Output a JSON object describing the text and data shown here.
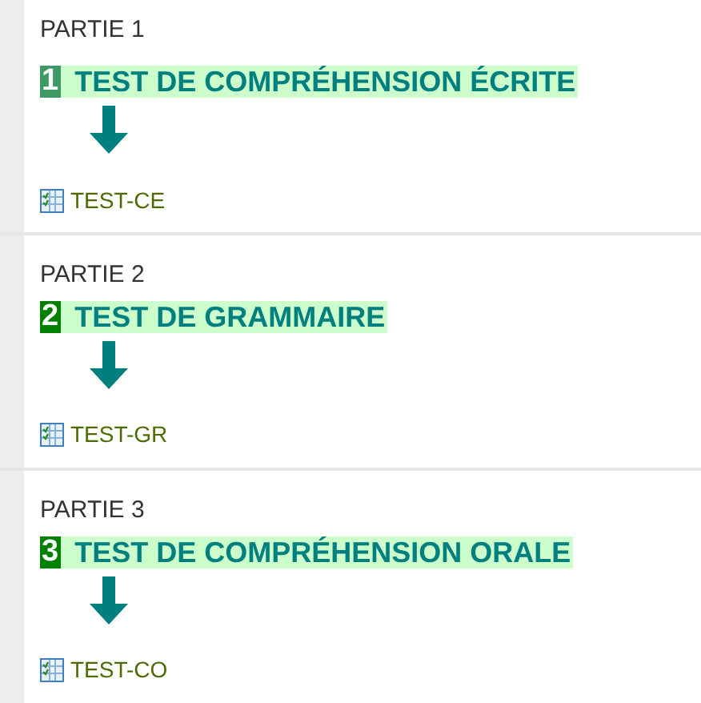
{
  "sections": [
    {
      "part": "PARTIE 1",
      "number": "1",
      "color": "#3d9a64",
      "title": "TEST DE COMPRÉHENSION ÉCRITE",
      "link": "TEST-CE"
    },
    {
      "part": "PARTIE 2",
      "number": "2",
      "color": "#008000",
      "title": "TEST DE GRAMMAIRE",
      "link": "TEST-GR"
    },
    {
      "part": "PARTIE 3",
      "number": "3",
      "color": "#008000",
      "title": "TEST DE COMPRÉHENSION ORALE",
      "link": "TEST-CO"
    }
  ]
}
